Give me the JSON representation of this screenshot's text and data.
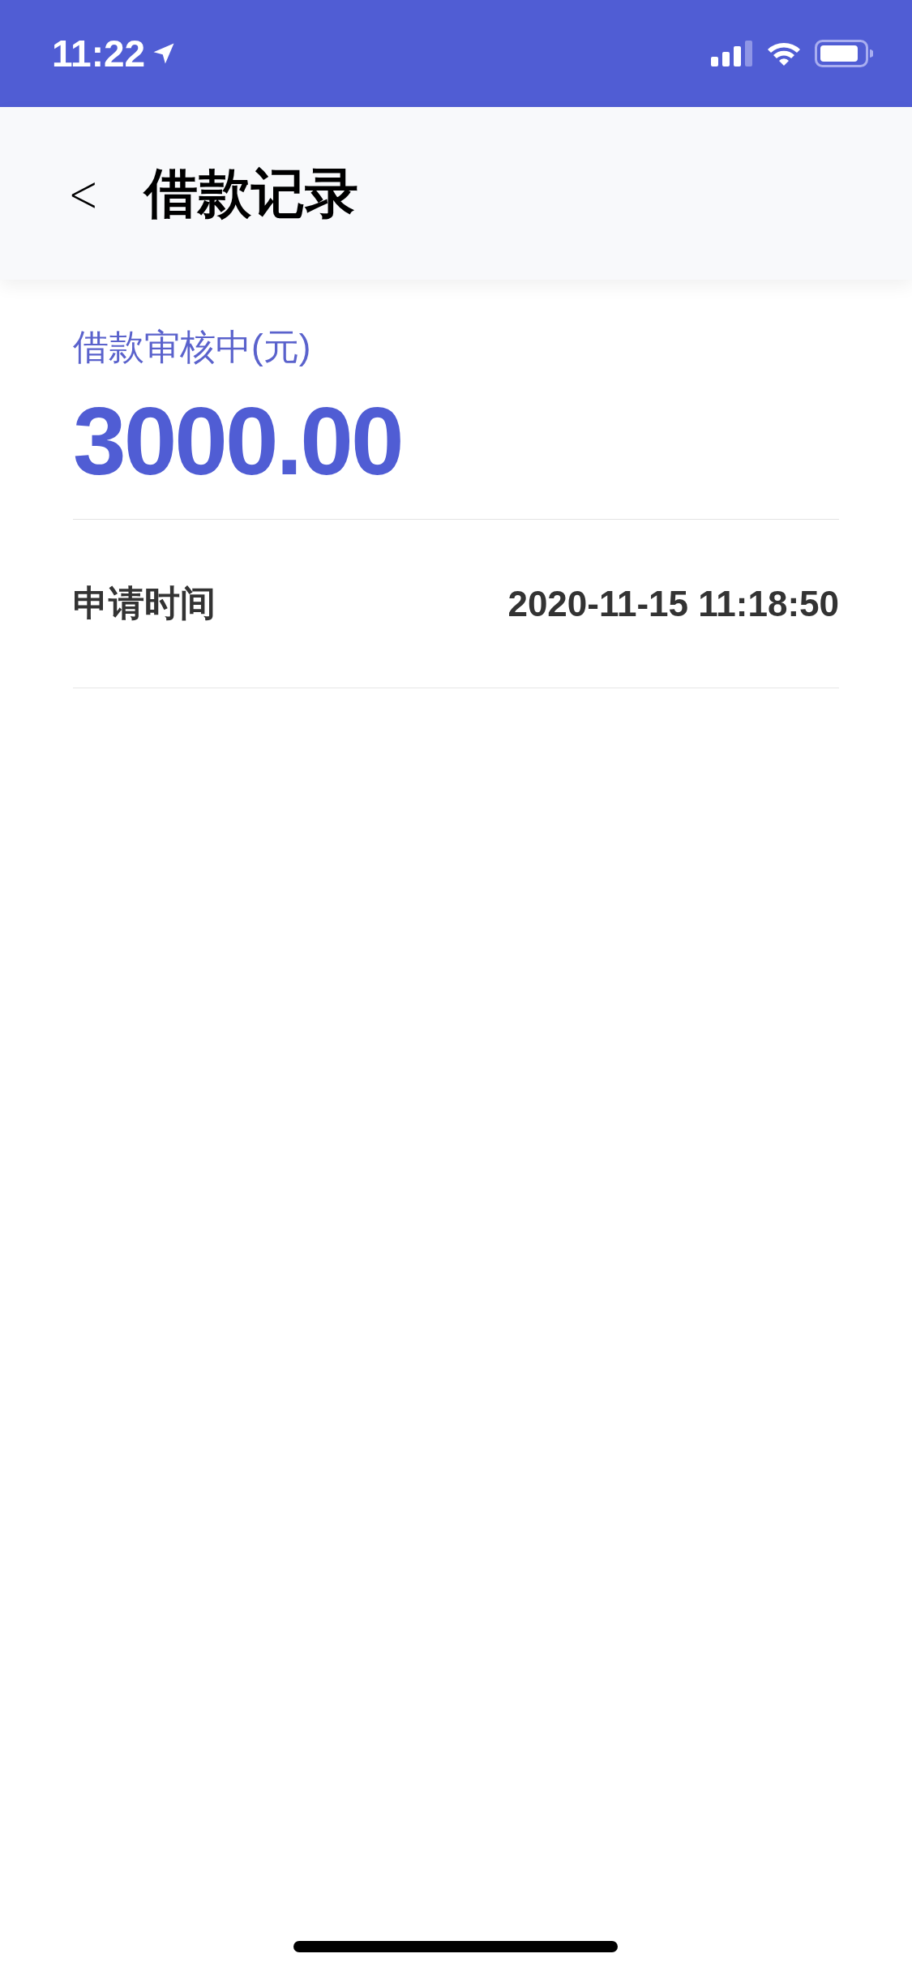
{
  "status_bar": {
    "time": "11:22"
  },
  "nav_bar": {
    "back": "<",
    "title": "借款记录"
  },
  "loan": {
    "status_label": "借款审核中(元)",
    "amount": "3000.00"
  },
  "details": [
    {
      "label": "申请时间",
      "value": "2020-11-15 11:18:50"
    }
  ]
}
